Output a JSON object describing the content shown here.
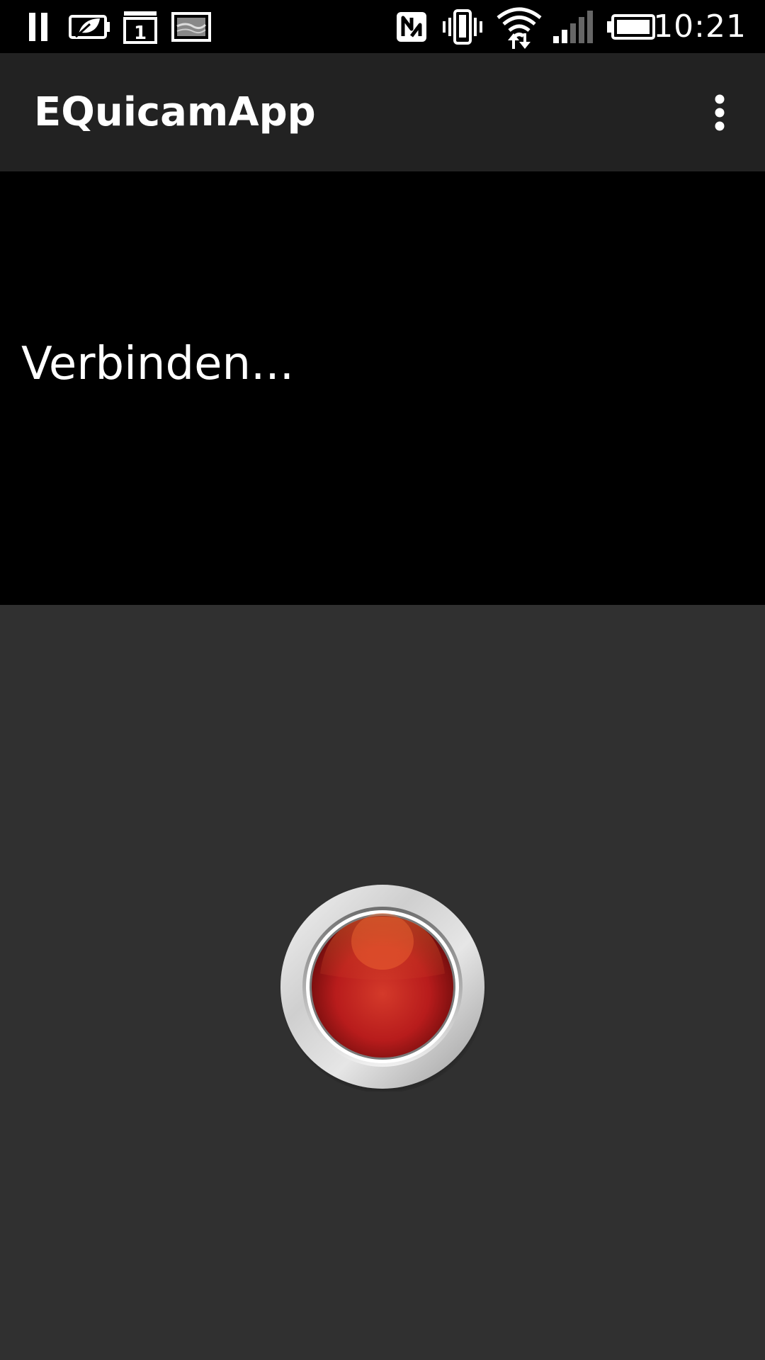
{
  "status_bar": {
    "time": "10:21",
    "left_icons": [
      "pause-icon",
      "battery-saver-icon",
      "calendar-icon",
      "image-icon"
    ],
    "calendar_day": "1",
    "right_icons": [
      "nfc-icon",
      "vibrate-icon",
      "wifi-icon",
      "signal-icon",
      "battery-icon"
    ]
  },
  "app_bar": {
    "title": "EQuicamApp",
    "overflow_icon": "more-vertical-icon"
  },
  "preview": {
    "status_text": "Verbinden..."
  },
  "record_button": {
    "icon": "record-button-icon",
    "color": "#c8201e"
  },
  "colors": {
    "status_bar_bg": "#000000",
    "app_bar_bg": "#222222",
    "preview_bg": "#000000",
    "screen_bg": "#303030",
    "text": "#ffffff"
  }
}
